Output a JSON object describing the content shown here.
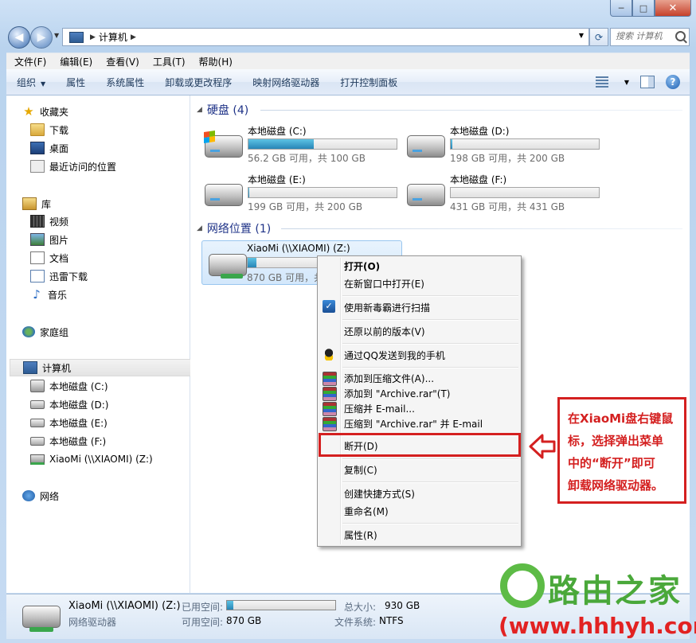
{
  "window": {
    "caption_min": "─",
    "caption_max": "□",
    "caption_close": "✕"
  },
  "address": {
    "location": "计算机",
    "search_placeholder": "搜索 计算机"
  },
  "menubar": [
    "文件(F)",
    "编辑(E)",
    "查看(V)",
    "工具(T)",
    "帮助(H)"
  ],
  "toolbar": [
    "组织",
    "属性",
    "系统属性",
    "卸载或更改程序",
    "映射网络驱动器",
    "打开控制面板"
  ],
  "nav": {
    "favorites": "收藏夹",
    "downloads": "下载",
    "desktop": "桌面",
    "recent": "最近访问的位置",
    "libraries": "库",
    "videos": "视频",
    "pictures": "图片",
    "documents": "文档",
    "xunlei": "迅雷下载",
    "music": "音乐",
    "homegroup": "家庭组",
    "computer": "计算机",
    "drive_c": "本地磁盘 (C:)",
    "drive_d": "本地磁盘 (D:)",
    "drive_e": "本地磁盘 (E:)",
    "drive_f": "本地磁盘 (F:)",
    "drive_z": "XiaoMi (\\\\XIAOMI) (Z:)",
    "network": "网络"
  },
  "groups": {
    "hard_disks": "硬盘 (4)",
    "network_locations": "网络位置 (1)"
  },
  "drives": [
    {
      "name": "本地磁盘 (C:)",
      "free": "56.2 GB 可用，共 100 GB",
      "used_fraction": 0.44
    },
    {
      "name": "本地磁盘 (D:)",
      "free": "198 GB 可用，共 200 GB",
      "used_fraction": 0.01
    },
    {
      "name": "本地磁盘 (E:)",
      "free": "199 GB 可用，共 200 GB",
      "used_fraction": 0.005
    },
    {
      "name": "本地磁盘 (F:)",
      "free": "431 GB 可用，共 431 GB",
      "used_fraction": 0.0
    }
  ],
  "network_drive": {
    "name": "XiaoMi (\\\\XIAOMI) (Z:)",
    "free": "870 GB 可用，共",
    "used_fraction": 0.06
  },
  "context_menu": {
    "open": "打开(O)",
    "open_new_window": "在新窗口中打开(E)",
    "scan": "使用新毒霸进行扫描",
    "restore": "还原以前的版本(V)",
    "qq_send": "通过QQ发送到我的手机",
    "add_archive": "添加到压缩文件(A)...",
    "add_to_rar": "添加到 \"Archive.rar\"(T)",
    "compress_email": "压缩并 E-mail...",
    "compress_rar_email": "压缩到 \"Archive.rar\" 并 E-mail",
    "disconnect": "断开(D)",
    "copy": "复制(C)",
    "create_shortcut": "创建快捷方式(S)",
    "rename": "重命名(M)",
    "properties": "属性(R)"
  },
  "callout": {
    "line1": "在XiaoMi盘右键鼠",
    "line2": "标，选择弹出菜单",
    "line3": "中的“断开”即可",
    "line4": "卸载网络驱动器。"
  },
  "details": {
    "name": "XiaoMi (\\\\XIAOMI) (Z:)",
    "type": "网络驱动器",
    "used_label": "已用空间:",
    "free_label": "可用空间:",
    "free_value": "870 GB",
    "total_label": "总大小:",
    "total_value": "930 GB",
    "fs_label": "文件系统:",
    "fs_value": "NTFS",
    "used_fraction": 0.06
  },
  "watermark": {
    "title": "路由之家",
    "url": "(www.hhhyh.com)"
  },
  "colors": {
    "accent_red": "#d42020",
    "bar_blue": "#2785b6",
    "watermark_green": "#4aa83a"
  }
}
